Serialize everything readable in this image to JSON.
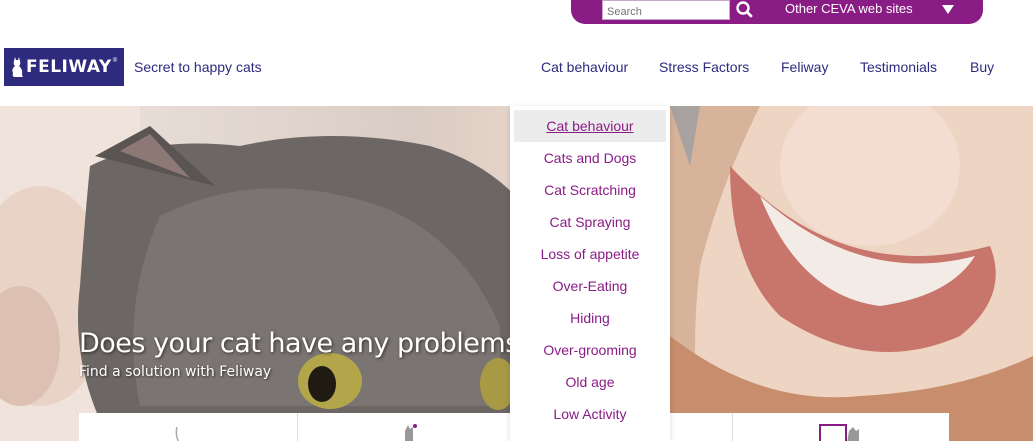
{
  "topbar": {
    "search_placeholder": "Search",
    "other_sites_label": "Other CEVA web sites"
  },
  "header": {
    "logo_text": "FELIWAY",
    "logo_tm": "®",
    "tagline": "Secret to happy cats"
  },
  "nav": [
    {
      "label": "Cat behaviour"
    },
    {
      "label": "Stress Factors"
    },
    {
      "label": "Feliway"
    },
    {
      "label": "Testimonials"
    },
    {
      "label": "Buy"
    }
  ],
  "dropdown": [
    {
      "label": "Cat behaviour"
    },
    {
      "label": "Cats and Dogs"
    },
    {
      "label": "Cat Scratching"
    },
    {
      "label": "Cat Spraying"
    },
    {
      "label": "Loss of appetite"
    },
    {
      "label": "Over-Eating"
    },
    {
      "label": "Hiding"
    },
    {
      "label": "Over-grooming"
    },
    {
      "label": "Old age"
    },
    {
      "label": "Low Activity"
    }
  ],
  "hero": {
    "title": "Does your cat have any problems",
    "subtitle": "Find a solution with Feliway"
  },
  "colors": {
    "brand_navy": "#2e2a7e",
    "brand_purple": "#8a1c86"
  }
}
